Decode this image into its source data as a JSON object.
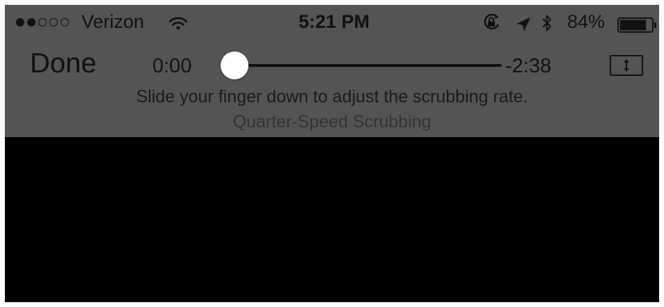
{
  "status_bar": {
    "carrier": "Verizon",
    "signal_strength_dots": 2,
    "signal_total_dots": 5,
    "time": "5:21 PM",
    "battery_percent": "84%",
    "battery_level": 0.84,
    "icons": [
      "wifi-icon",
      "rotation-lock-icon",
      "location-arrow-icon",
      "bluetooth-icon",
      "battery-icon"
    ]
  },
  "player": {
    "done_label": "Done",
    "elapsed": "0:00",
    "remaining": "-2:38",
    "progress": 0.0,
    "aspect_icon": "expand-vertical-icon"
  },
  "scrubbing": {
    "hint": "Slide your finger down to adjust the scrubbing rate.",
    "speed_label": "Quarter-Speed Scrubbing"
  },
  "colors": {
    "top_bar": "#545454",
    "video_area": "#000000",
    "thumb": "#ffffff",
    "foreground": "#111111"
  }
}
